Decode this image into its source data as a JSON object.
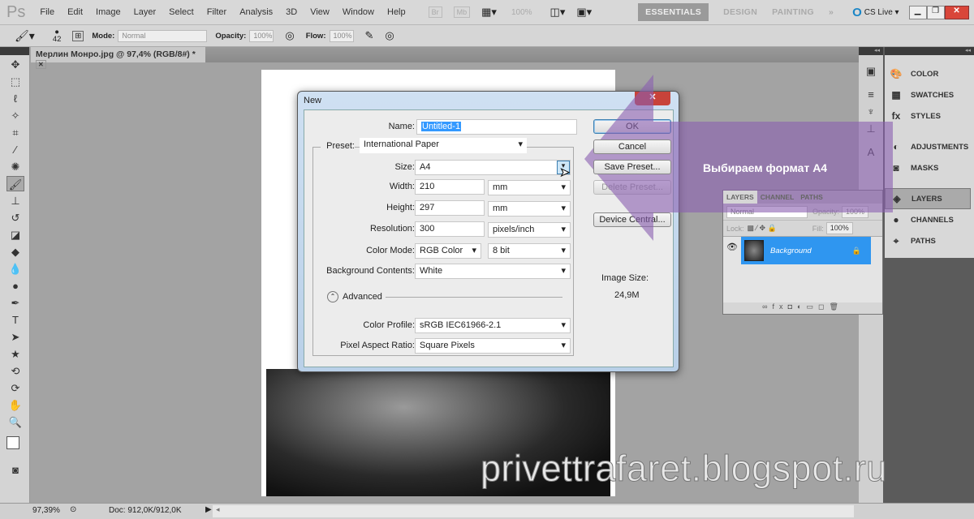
{
  "app": {
    "logo": "Ps",
    "menu": [
      "File",
      "Edit",
      "Image",
      "Layer",
      "Select",
      "Filter",
      "Analysis",
      "3D",
      "View",
      "Window",
      "Help"
    ],
    "zoom_field": "100%",
    "workspaces": [
      "ESSENTIALS",
      "DESIGN",
      "PAINTING"
    ],
    "more": "»",
    "cs_live": "CS Live ▾"
  },
  "options": {
    "brush_size": "42",
    "mode_label": "Mode:",
    "mode_value": "Normal",
    "opacity_label": "Opacity:",
    "opacity_value": "100%",
    "flow_label": "Flow:",
    "flow_value": "100%"
  },
  "document": {
    "tab_title": "Мерлин Монро.jpg @ 97,4% (RGB/8#) *"
  },
  "dialog": {
    "title": "New",
    "name_label": "Name:",
    "name_value": "Untitled-1",
    "preset_label": "Preset:",
    "preset_value": "International Paper",
    "size_label": "Size:",
    "size_value": "A4",
    "width_label": "Width:",
    "width_value": "210",
    "width_unit": "mm",
    "height_label": "Height:",
    "height_value": "297",
    "height_unit": "mm",
    "resolution_label": "Resolution:",
    "resolution_value": "300",
    "resolution_unit": "pixels/inch",
    "color_mode_label": "Color Mode:",
    "color_mode_value": "RGB Color",
    "bit_value": "8 bit",
    "bg_label": "Background Contents:",
    "bg_value": "White",
    "advanced_label": "Advanced",
    "profile_label": "Color Profile:",
    "profile_value": "sRGB IEC61966-2.1",
    "par_label": "Pixel Aspect Ratio:",
    "par_value": "Square Pixels",
    "ok": "OK",
    "cancel": "Cancel",
    "save_preset": "Save Preset...",
    "delete_preset": "Delete Preset...",
    "device_central": "Device Central...",
    "image_size_label": "Image Size:",
    "image_size_value": "24,9M"
  },
  "panels": {
    "items": [
      "COLOR",
      "SWATCHES",
      "STYLES",
      "ADJUSTMENTS",
      "MASKS",
      "LAYERS",
      "CHANNELS",
      "PATHS"
    ]
  },
  "layers": {
    "tabs": [
      "LAYERS",
      "CHANNEL",
      "PATHS"
    ],
    "blend": "Normal",
    "opacity_label": "Opacity:",
    "opacity": "100%",
    "lock_label": "Lock:",
    "fill_label": "Fill:",
    "fill": "100%",
    "layer_name": "Background"
  },
  "status": {
    "zoom": "97,39%",
    "doc": "Doc: 912,0K/912,0K"
  },
  "annotation": {
    "callout": "Выбираем формат А4",
    "watermark": "privettrafaret.blogspot.ru",
    "arrow_color": "#8a5fb0"
  }
}
